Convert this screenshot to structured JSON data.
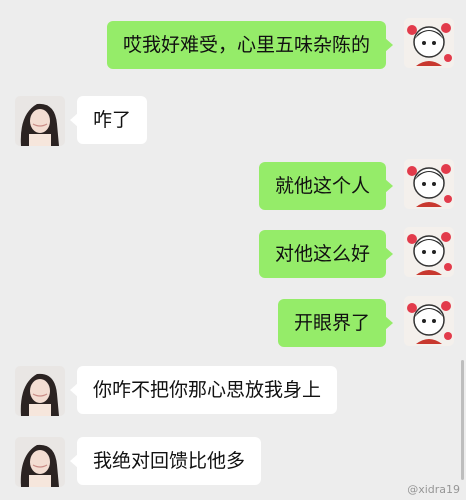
{
  "messages": [
    {
      "side": "out",
      "text": "哎我好难受，心里五味杂陈的",
      "avatar_icon": "cartoon-avatar-icon"
    },
    {
      "side": "in",
      "text": "咋了",
      "avatar_icon": "girl-photo-avatar-icon"
    },
    {
      "side": "out",
      "text": "就他这个人",
      "avatar_icon": "cartoon-avatar-icon"
    },
    {
      "side": "out",
      "text": "对他这么好",
      "avatar_icon": "cartoon-avatar-icon"
    },
    {
      "side": "out",
      "text": "开眼界了",
      "avatar_icon": "cartoon-avatar-icon"
    },
    {
      "side": "in",
      "text": "你咋不把你那心思放我身上",
      "avatar_icon": "girl-photo-avatar-icon"
    },
    {
      "side": "in",
      "text": "我绝对回馈比他多",
      "avatar_icon": "girl-photo-avatar-icon"
    }
  ],
  "watermark": "@xidra19",
  "colors": {
    "background": "#ededed",
    "outgoing_bubble": "#95ec69",
    "incoming_bubble": "#ffffff"
  }
}
